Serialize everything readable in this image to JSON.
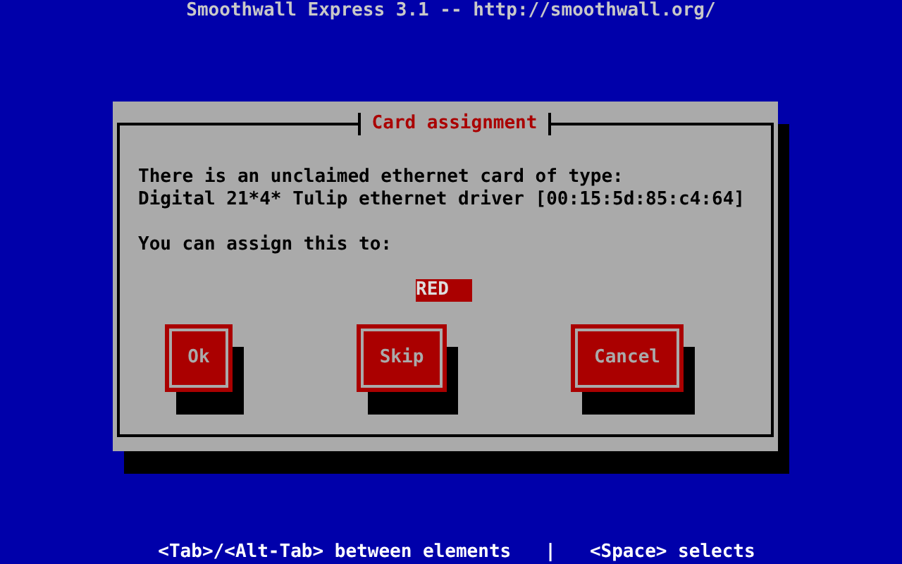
{
  "screen_title": "Smoothwall Express 3.1 -- http://smoothwall.org/",
  "dialog": {
    "title": "Card assignment",
    "message_lines": [
      "There is an unclaimed ethernet card of type:",
      "Digital 21*4* Tulip ethernet driver [00:15:5d:85:c4:64]"
    ],
    "prompt": "You can assign this to:",
    "choices": [
      {
        "label": "RED",
        "selected": true
      }
    ],
    "buttons": [
      {
        "label": "Ok"
      },
      {
        "label": "Skip"
      },
      {
        "label": "Cancel"
      }
    ]
  },
  "help_line": [
    "<Tab>/<Alt-Tab> between elements",
    "|",
    "<Space> selects"
  ]
}
